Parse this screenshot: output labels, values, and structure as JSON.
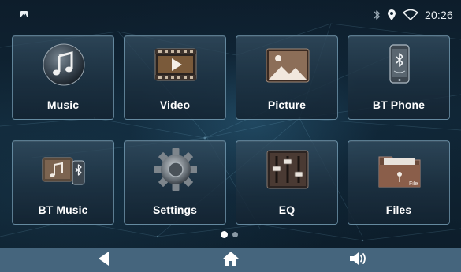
{
  "status_bar": {
    "time": "20:26",
    "icons": [
      "image-notification-icon",
      "bluetooth-icon",
      "location-pin-icon",
      "wifi-icon"
    ]
  },
  "apps": [
    {
      "label": "Music",
      "icon": "music-note-icon"
    },
    {
      "label": "Video",
      "icon": "film-play-icon"
    },
    {
      "label": "Picture",
      "icon": "landscape-picture-icon"
    },
    {
      "label": "BT Phone",
      "icon": "bluetooth-phone-icon"
    },
    {
      "label": "BT Music",
      "icon": "bluetooth-music-icon"
    },
    {
      "label": "Settings",
      "icon": "gear-icon"
    },
    {
      "label": "EQ",
      "icon": "equalizer-sliders-icon"
    },
    {
      "label": "Files",
      "icon": "folder-icon",
      "icon_text": "File"
    }
  ],
  "pagination": {
    "pages": 2,
    "current": 1
  },
  "nav_bar": {
    "buttons": [
      "back-icon",
      "home-icon",
      "volume-icon"
    ]
  },
  "colors": {
    "nav_bar_bg": "#45657d",
    "tile_border": "#96c3dc",
    "text": "#ffffff"
  }
}
